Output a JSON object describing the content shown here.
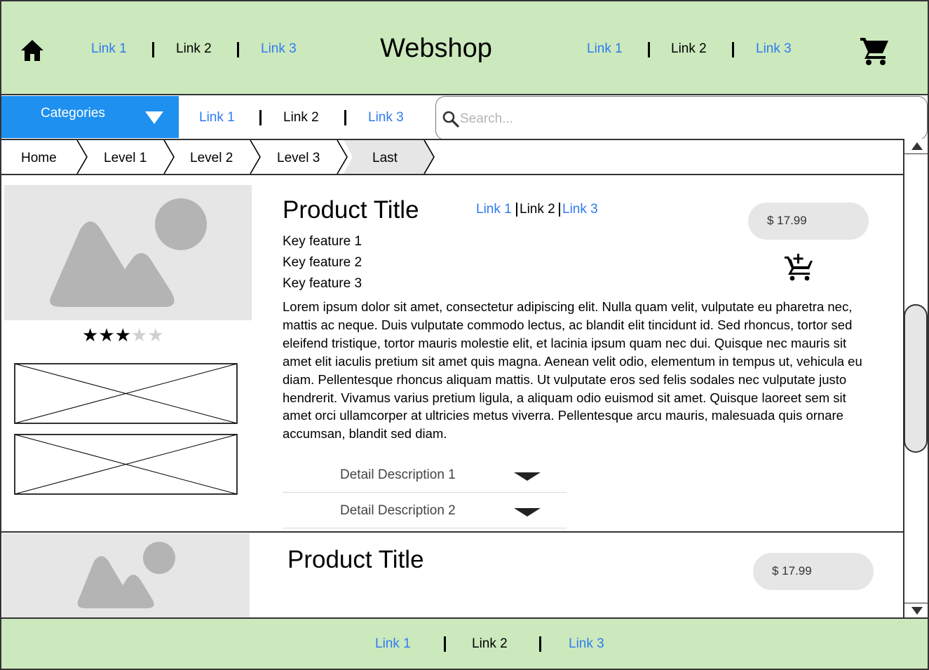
{
  "header": {
    "brand": "Webshop",
    "home_icon": "home-icon",
    "cart_icon": "shopping-cart-icon",
    "left_links": [
      "Link 1",
      "Link 2",
      "Link 3"
    ],
    "right_links": [
      "Link 1",
      "Link 2",
      "Link 3"
    ]
  },
  "subnav": {
    "categories_label": "Categories",
    "links": [
      "Link 1",
      "Link 2",
      "Link 3"
    ],
    "search_placeholder": "Search..."
  },
  "breadcrumb": [
    "Home",
    "Level 1",
    "Level 2",
    "Level 3",
    "Last"
  ],
  "products": [
    {
      "title": "Product Title",
      "links": [
        "Link 1",
        "Link 2",
        "Link 3"
      ],
      "price": "$ 17.99",
      "rating": 3,
      "rating_max": 5,
      "features": [
        "Key feature 1",
        "Key feature 2",
        "Key feature 3"
      ],
      "description": "Lorem ipsum dolor sit amet, consectetur adipiscing elit. Nulla quam velit, vulputate eu pharetra nec, mattis ac neque. Duis vulputate commodo lectus, ac blandit elit tincidunt id. Sed rhoncus, tortor sed eleifend tristique, tortor mauris molestie elit, et lacinia ipsum quam nec dui. Quisque nec mauris sit amet elit iaculis pretium sit amet quis magna. Aenean velit odio, elementum in tempus ut, vehicula eu diam. Pellentesque rhoncus aliquam mattis. Ut vulputate eros sed felis sodales nec vulputate justo hendrerit. Vivamus varius pretium ligula, a aliquam odio euismod sit amet. Quisque laoreet sem sit amet orci ullamcorper at ultricies metus viverra. Pellentesque arcu mauris, malesuada quis ornare accumsan, blandit sed diam.",
      "details": [
        "Detail Description 1",
        "Detail Description 2"
      ],
      "add_to_cart_icon": "add-to-cart-icon"
    },
    {
      "title": "Product Title",
      "price": "$ 17.99"
    }
  ],
  "footer": {
    "links": [
      "Link 1",
      "Link 2",
      "Link 3"
    ]
  },
  "colors": {
    "header_bg": "#cce8bd",
    "accent_blue": "#1e90f0",
    "link_blue": "#2f7bf0",
    "placeholder_gray": "#e6e6e6"
  }
}
